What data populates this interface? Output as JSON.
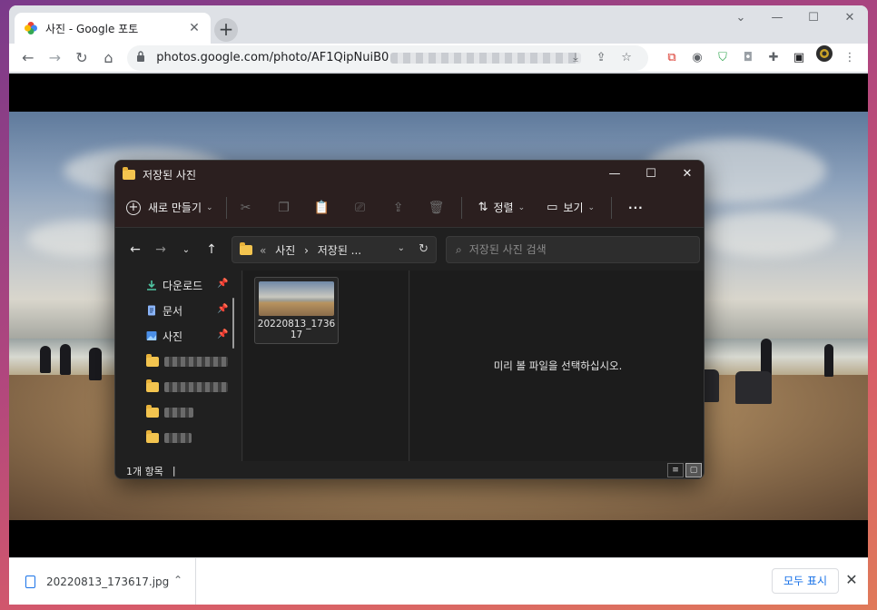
{
  "browser": {
    "tab": {
      "title": "사진 - Google 포토",
      "close": "✕"
    },
    "new_tab": "+",
    "window_controls": [
      "⌄",
      "—",
      "☐",
      "✕"
    ],
    "url_visible": "photos.google.com/photo/AF1QipNuiB0",
    "nav": {
      "back": "←",
      "forward": "→",
      "reload": "↻",
      "home": "⌂"
    }
  },
  "explorer": {
    "title": "저장된 사진",
    "window_controls": [
      "—",
      "☐",
      "✕"
    ],
    "new_button": "새로 만들기",
    "sort_label": "정렬",
    "view_label": "보기",
    "more": "···",
    "breadcrumb": {
      "prefix": "«",
      "path1": "사진",
      "sep": "›",
      "path2": "저장된 ..."
    },
    "search_placeholder": "저장된 사진 검색",
    "sidebar": [
      {
        "label": "다운로드",
        "icon": "download-icon",
        "pinned": true
      },
      {
        "label": "문서",
        "icon": "document-icon",
        "pinned": true
      },
      {
        "label": "사진",
        "icon": "pictures-icon",
        "pinned": true
      }
    ],
    "file": {
      "name": "20220813_173617"
    },
    "preview_text": "미리 볼 파일을 선택하십시오.",
    "status": "1개 항목",
    "status_sep": "|"
  },
  "download_bar": {
    "file_name": "20220813_173617.jpg",
    "show_all": "모두 표시",
    "close": "✕"
  },
  "colors": {
    "chrome_frame": "#dee1e6",
    "explorer_bg": "#202020",
    "explorer_title_bg": "#2b1f1f",
    "folder": "#f3c44f",
    "link_blue": "#1a73e8"
  }
}
